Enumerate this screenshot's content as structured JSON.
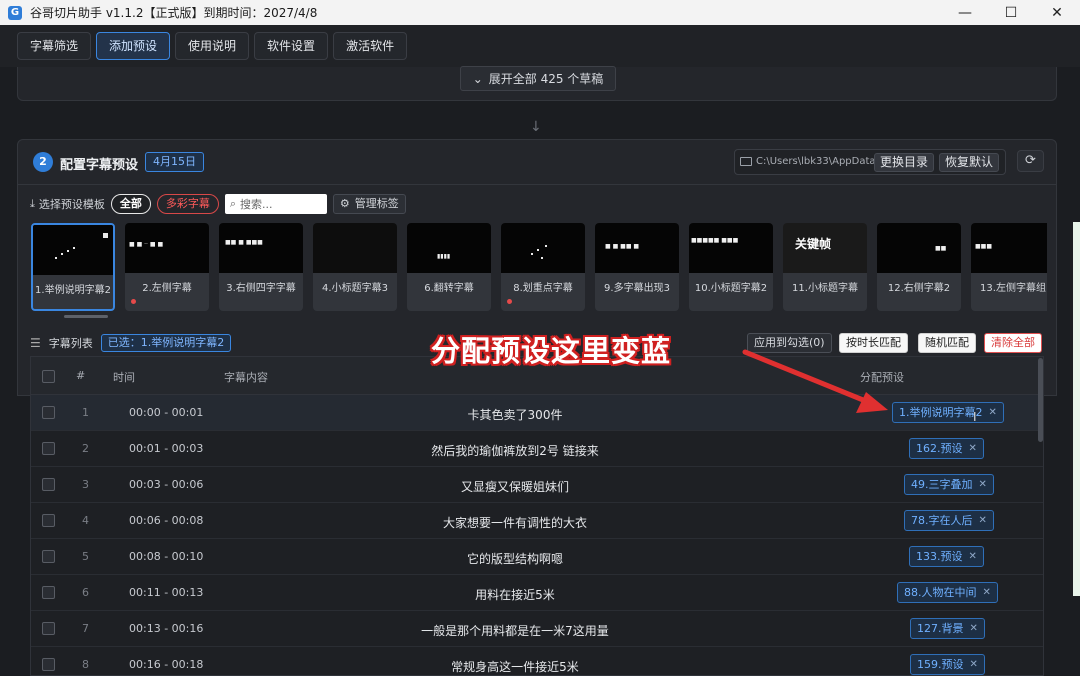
{
  "window": {
    "title": "谷哥切片助手 v1.1.2【正式版】到期时间：2027/4/8",
    "app_icon": "G",
    "minimize": "—",
    "maximize": "☐",
    "close": "✕"
  },
  "menu": [
    "字幕筛选",
    "添加预设",
    "使用说明",
    "软件设置",
    "激活软件"
  ],
  "expand": {
    "label": "展开全部 425 个草稿",
    "icon": "⌄"
  },
  "down_arrow": "↓",
  "preset_section": {
    "step": "2",
    "title": "配置字幕预设",
    "date": "4月15日",
    "path": "C:\\Users\\lbk33\\AppData\\...",
    "change_dir": "更换目录",
    "restore_default": "恢复默认",
    "refresh": "⟳",
    "template_label": "选择预设模板",
    "filter_all": "全部",
    "filter_color": "多彩字幕",
    "search_placeholder": "搜索...",
    "manage_tags": "管理标签"
  },
  "templates": [
    {
      "label": "1.举例说明字幕2",
      "dot": true,
      "selected": true
    },
    {
      "label": "2.左侧字幕",
      "dot": true
    },
    {
      "label": "3.右侧四字字幕"
    },
    {
      "label": "4.小标题字幕3"
    },
    {
      "label": "6.翻转字幕"
    },
    {
      "label": "8.划重点字幕",
      "dot": true
    },
    {
      "label": "9.多字幕出现3"
    },
    {
      "label": "10.小标题字幕2"
    },
    {
      "label": "11.小标题字幕",
      "big_text": "关键帧"
    },
    {
      "label": "12.右侧字幕2"
    },
    {
      "label": "13.左侧字幕组"
    }
  ],
  "list": {
    "title": "字幕列表",
    "selected": "已选：1.举例说明字幕2",
    "apply_checked": "应用到勾选(0)",
    "match_duration": "按时长匹配",
    "random_match": "随机匹配",
    "clear_all": "清除全部",
    "columns": {
      "index": "#",
      "time": "时间",
      "content": "字幕内容",
      "preset": "分配预设"
    },
    "rows": [
      {
        "idx": "1",
        "time": "00:00 - 00:01",
        "text": "卡其色卖了300件",
        "preset": "1.举例说明字幕2"
      },
      {
        "idx": "2",
        "time": "00:01 - 00:03",
        "text": "然后我的瑜伽裤放到2号 链接来",
        "preset": "162.预设"
      },
      {
        "idx": "3",
        "time": "00:03 - 00:06",
        "text": "又显瘦又保暖姐妹们",
        "preset": "49.三字叠加"
      },
      {
        "idx": "4",
        "time": "00:06 - 00:08",
        "text": "大家想要一件有调性的大衣",
        "preset": "78.字在人后"
      },
      {
        "idx": "5",
        "time": "00:08 - 00:10",
        "text": "它的版型结构啊嗯",
        "preset": "133.预设"
      },
      {
        "idx": "6",
        "time": "00:11 - 00:13",
        "text": "用料在接近5米",
        "preset": "88.人物在中间"
      },
      {
        "idx": "7",
        "time": "00:13 - 00:16",
        "text": "一般是那个用料都是在一米7这用量",
        "preset": "127.背景"
      },
      {
        "idx": "8",
        "time": "00:16 - 00:18",
        "text": "常规身高这一件接近5米",
        "preset": "159.预设"
      }
    ],
    "remove_icon": "✕"
  },
  "annotation": {
    "text": "分配预设这里变蓝",
    "color": "#e03030"
  },
  "colors": {
    "accent": "#3a86e0",
    "background": "#1b1d21",
    "danger": "#e05050"
  },
  "icons": {
    "search": "⌕",
    "gear": "⚙",
    "list": "☰",
    "download": "⤓",
    "cursor": "I"
  }
}
